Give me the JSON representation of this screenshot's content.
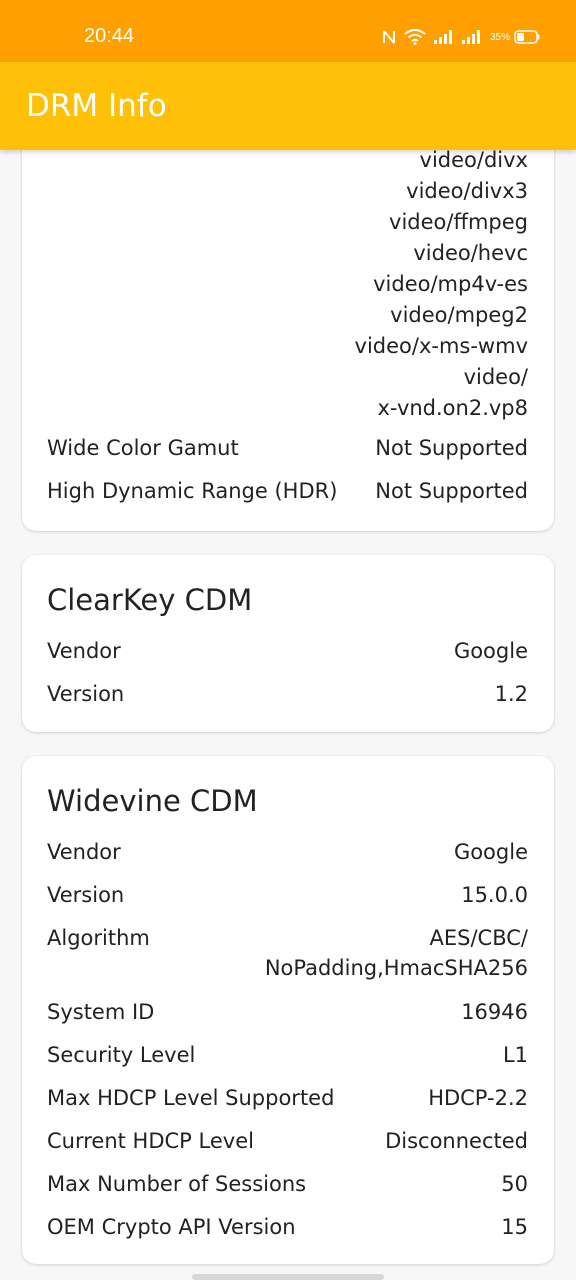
{
  "status_bar": {
    "time": "20:44",
    "battery_percent": "35%",
    "icons": [
      "nfc-icon",
      "wifi-icon",
      "signal-icon",
      "signal-icon",
      "battery-icon"
    ]
  },
  "app_bar": {
    "title": "DRM Info"
  },
  "colors": {
    "status_bar": "#ffa000",
    "app_bar": "#ffc107",
    "card": "#ffffff",
    "background": "#f7f7f7"
  },
  "top_card": {
    "codecs": [
      "video/divx",
      "video/divx3",
      "video/ffmpeg",
      "video/hevc",
      "video/mp4v-es",
      "video/mpeg2",
      "video/x-ms-wmv",
      "video/",
      "x-vnd.on2.vp8"
    ],
    "rows": [
      {
        "label": "Wide Color Gamut",
        "value": "Not Supported"
      },
      {
        "label": "High Dynamic Range (HDR)",
        "value": "Not Supported"
      }
    ]
  },
  "clearkey": {
    "title": "ClearKey CDM",
    "rows": [
      {
        "label": "Vendor",
        "value": "Google"
      },
      {
        "label": "Version",
        "value": "1.2"
      }
    ]
  },
  "widevine": {
    "title": "Widevine CDM",
    "rows": [
      {
        "label": "Vendor",
        "value": "Google"
      },
      {
        "label": "Version",
        "value": "15.0.0"
      },
      {
        "label": "Algorithm",
        "value_lines": [
          "AES/CBC/",
          "NoPadding,HmacSHA256"
        ]
      },
      {
        "label": "System ID",
        "value": "16946"
      },
      {
        "label": "Security Level",
        "value": "L1"
      },
      {
        "label": "Max HDCP Level Supported",
        "value": "HDCP-2.2"
      },
      {
        "label": "Current HDCP Level",
        "value": "Disconnected"
      },
      {
        "label": "Max Number of Sessions",
        "value": "50"
      },
      {
        "label": "OEM Crypto API Version",
        "value": "15"
      }
    ]
  }
}
